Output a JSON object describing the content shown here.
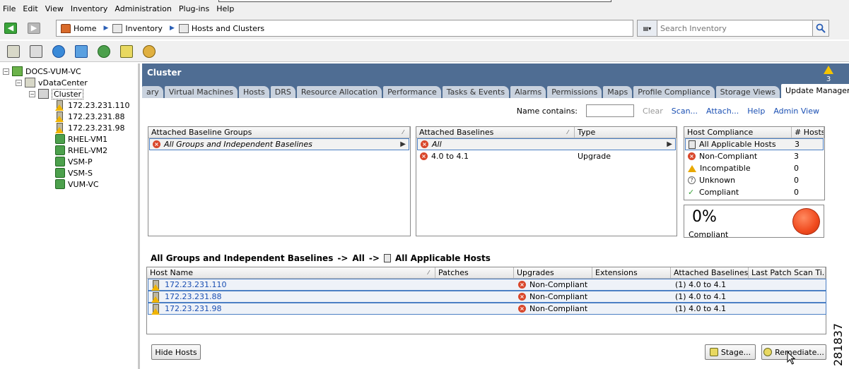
{
  "menu": [
    "File",
    "Edit",
    "View",
    "Inventory",
    "Administration",
    "Plug-ins",
    "Help"
  ],
  "breadcrumb": [
    "Home",
    "Inventory",
    "Hosts and Clusters"
  ],
  "search": {
    "placeholder": "Search Inventory"
  },
  "tree": {
    "root": "DOCS-VUM-VC",
    "datacenter": "vDataCenter",
    "cluster": "Cluster",
    "hosts": [
      "172.23.231.110",
      "172.23.231.88",
      "172.23.231.98"
    ],
    "vms": [
      "RHEL-VM1",
      "RHEL-VM2",
      "VSM-P",
      "VSM-S",
      "VUM-VC"
    ]
  },
  "main": {
    "title": "Cluster",
    "alert_count": "3",
    "tabs": [
      "ary",
      "Virtual Machines",
      "Hosts",
      "DRS",
      "Resource Allocation",
      "Performance",
      "Tasks & Events",
      "Alarms",
      "Permissions",
      "Maps",
      "Profile Compliance",
      "Storage Views",
      "Update Manager"
    ],
    "active_tab": "Update Manager"
  },
  "actions": {
    "name_contains_label": "Name contains:",
    "clear": "Clear",
    "scan": "Scan...",
    "attach": "Attach...",
    "help": "Help",
    "admin_view": "Admin View"
  },
  "baseline_groups": {
    "header": "Attached Baseline Groups",
    "rows": [
      "All Groups and Independent Baselines"
    ]
  },
  "baselines": {
    "header_name": "Attached Baselines",
    "header_type": "Type",
    "rows": [
      {
        "name": "All",
        "type": ""
      },
      {
        "name": "4.0 to 4.1",
        "type": "Upgrade"
      }
    ]
  },
  "compliance": {
    "header_name": "Host Compliance",
    "header_count": "# Hosts",
    "rows": [
      {
        "label": "All Applicable Hosts",
        "count": "3"
      },
      {
        "label": "Non-Compliant",
        "count": "3"
      },
      {
        "label": "Incompatible",
        "count": "0"
      },
      {
        "label": "Unknown",
        "count": "0"
      },
      {
        "label": "Compliant",
        "count": "0"
      }
    ],
    "percent": "0%",
    "percent_label": "Compliant",
    "status_color": "#f04a1e"
  },
  "path": {
    "group": "All Groups and Independent Baselines",
    "arrow": "->",
    "baseline": "All",
    "hosts": "All Applicable Hosts"
  },
  "hosts_grid": {
    "headers": [
      "Host Name",
      "Patches",
      "Upgrades",
      "Extensions",
      "Attached Baselines",
      "Last Patch Scan Ti..."
    ],
    "rows": [
      {
        "host": "172.23.231.110",
        "upgrades": "Non-Compliant",
        "baselines": "(1) 4.0 to 4.1"
      },
      {
        "host": "172.23.231.88",
        "upgrades": "Non-Compliant",
        "baselines": "(1) 4.0 to 4.1"
      },
      {
        "host": "172.23.231.98",
        "upgrades": "Non-Compliant",
        "baselines": "(1) 4.0 to 4.1"
      }
    ]
  },
  "buttons": {
    "hide_hosts": "Hide Hosts",
    "stage": "Stage...",
    "remediate": "Remediate..."
  },
  "watermark": "281837"
}
